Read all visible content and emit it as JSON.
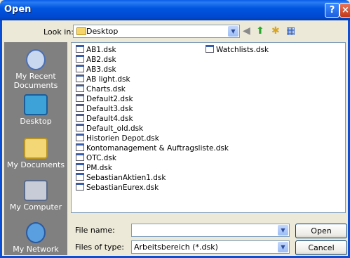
{
  "window": {
    "title": "Open",
    "help": "?",
    "close": "×"
  },
  "toolbar": {
    "look_in_label": "Look in:",
    "look_in_value": "Desktop"
  },
  "places": [
    "My Recent Documents",
    "Desktop",
    "My Documents",
    "My Computer",
    "My Network"
  ],
  "files": [
    "AB1.dsk",
    "AB2.dsk",
    "AB3.dsk",
    "AB light.dsk",
    "Charts.dsk",
    "Default2.dsk",
    "Default3.dsk",
    "Default4.dsk",
    "Default_old.dsk",
    "Historien Depot.dsk",
    "Kontomanagement & Auftragsliste.dsk",
    "OTC.dsk",
    "PM.dsk",
    "SebastianAktien1.dsk",
    "SebastianEurex.dsk",
    "Watchlists.dsk"
  ],
  "form": {
    "file_name_label": "File name:",
    "file_name_value": "",
    "file_type_label": "Files of type:",
    "file_type_value": "Arbeitsbereich (*.dsk)"
  },
  "buttons": {
    "open": "Open",
    "cancel": "Cancel"
  }
}
